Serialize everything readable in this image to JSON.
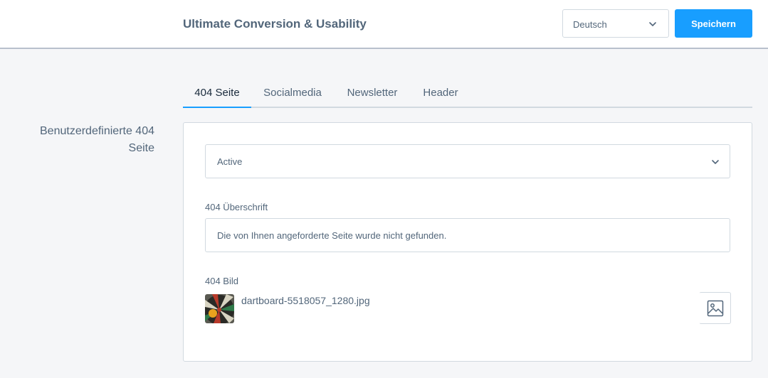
{
  "header": {
    "title": "Ultimate Conversion & Usability",
    "language_select": {
      "value": "Deutsch"
    },
    "save_label": "Speichern"
  },
  "tabs": [
    {
      "label": "404 Seite",
      "active": true
    },
    {
      "label": "Socialmedia",
      "active": false
    },
    {
      "label": "Newsletter",
      "active": false
    },
    {
      "label": "Header",
      "active": false
    }
  ],
  "section": {
    "label": "Benutzerdefinierte 404 Seite"
  },
  "form": {
    "status_select": {
      "value": "Active"
    },
    "heading_field": {
      "label": "404 Überschrift",
      "value": "Die von Ihnen angeforderte Seite wurde nicht gefunden."
    },
    "image_field": {
      "label": "404 Bild",
      "filename": "dartboard-5518057_1280.jpg"
    }
  },
  "icons": {
    "language_chevron": "chevron-down-icon",
    "status_chevron": "chevron-down-icon",
    "image_button": "image-icon"
  },
  "colors": {
    "accent": "#189eff",
    "text": "#52667a",
    "border": "#d1d9e0",
    "background": "#f5f6f8"
  }
}
